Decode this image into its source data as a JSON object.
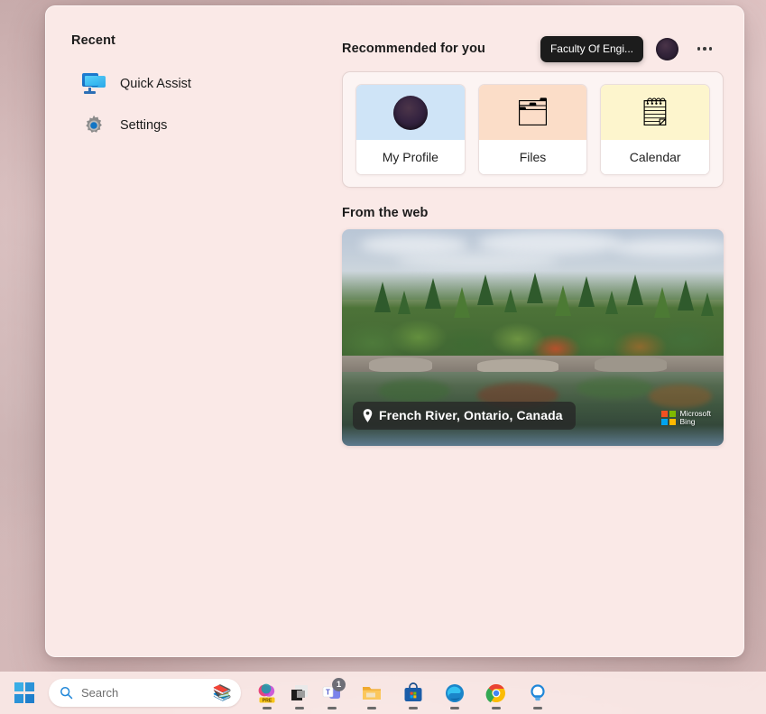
{
  "desktop": {
    "wallpaper_color": "#c9aeae"
  },
  "start_menu": {
    "background_color": "#fae9e7",
    "recent": {
      "heading": "Recent",
      "items": [
        {
          "label": "Quick Assist",
          "icon": "quick-assist-icon"
        },
        {
          "label": "Settings",
          "icon": "settings-gear-icon"
        }
      ]
    },
    "recommended": {
      "heading": "Recommended for you",
      "account_tooltip": "Faculty Of Engi...",
      "avatar_icon": "user-avatar",
      "more_icon": "more-options-icon",
      "cards": [
        {
          "label": "My Profile",
          "icon": "profile-avatar-icon",
          "thumb_color": "#cfe4f7"
        },
        {
          "label": "Files",
          "icon": "files-folder-icon",
          "thumb_color": "#fbddc8",
          "emoji": "🗂"
        },
        {
          "label": "Calendar",
          "icon": "calendar-notepad-icon",
          "thumb_color": "#fdf5cd",
          "emoji": "🗒"
        }
      ]
    },
    "from_the_web": {
      "heading": "From the web",
      "caption": "French River, Ontario, Canada",
      "pin_icon": "location-pin-icon",
      "attribution": {
        "line1": "Microsoft",
        "line2": "Bing",
        "logo_icon": "microsoft-bing-logo"
      }
    }
  },
  "taskbar": {
    "start_button": {
      "name": "Start",
      "icon": "windows-logo-icon"
    },
    "search": {
      "placeholder": "Search",
      "icon": "search-icon",
      "art_icon": "school-supplies-illustration"
    },
    "apps": [
      {
        "name": "Microsoft 365",
        "icon": "office-pre-icon",
        "badge": "PRE",
        "running": true
      },
      {
        "name": "App Window",
        "icon": "dark-window-icon",
        "running": true
      },
      {
        "name": "Microsoft Teams",
        "icon": "teams-icon",
        "badge": "1",
        "running": true
      },
      {
        "name": "File Explorer",
        "icon": "file-explorer-icon",
        "running": true
      },
      {
        "name": "Microsoft Store",
        "icon": "microsoft-store-icon",
        "running": true
      },
      {
        "name": "Microsoft Edge",
        "icon": "edge-icon",
        "running": true
      },
      {
        "name": "Google Chrome",
        "icon": "chrome-icon",
        "running": true
      },
      {
        "name": "Quick Assist",
        "icon": "quick-assist-bulb-icon",
        "running": true
      }
    ]
  }
}
